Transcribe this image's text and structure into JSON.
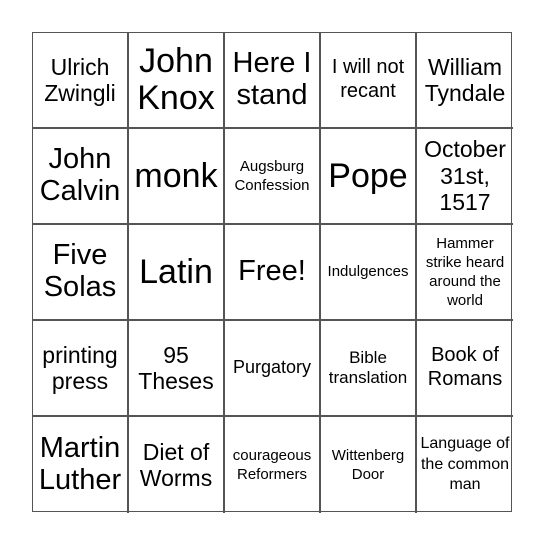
{
  "card": {
    "free_space_label": "Free!",
    "rows": [
      [
        "Ulrich Zwingli",
        "John Knox",
        "Here I stand",
        "I will not recant",
        "William Tyndale"
      ],
      [
        "John Calvin",
        "monk",
        "Augsburg Confession",
        "Pope",
        "October 31st, 1517"
      ],
      [
        "Five Solas",
        "Latin",
        "Free!",
        "Indulgences",
        "Hammer strike heard around the world"
      ],
      [
        "printing press",
        "95 Theses",
        "Purgatory",
        "Bible translation",
        "Book of Romans"
      ],
      [
        "Martin Luther",
        "Diet of Worms",
        "courageous Reformers",
        "Wittenberg Door",
        "Language of the common man"
      ]
    ],
    "colors": {
      "grid_line": "#555555",
      "text": "#000000",
      "background": "#ffffff"
    }
  }
}
